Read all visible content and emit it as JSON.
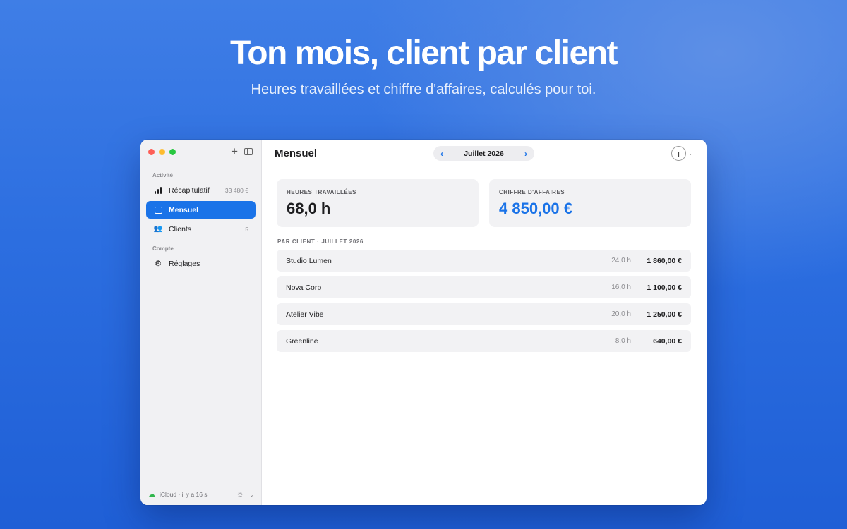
{
  "hero": {
    "title": "Ton mois, client par client",
    "subtitle": "Heures travaillées et chiffre d'affaires, calculés pour toi."
  },
  "sidebar": {
    "sections": [
      {
        "label": "Activité"
      },
      {
        "label": "Compte"
      }
    ],
    "items": [
      {
        "label": "Récapitulatif",
        "trail": "33 480 €",
        "icon": "bar-chart-icon"
      },
      {
        "label": "Mensuel",
        "trail": "",
        "icon": "calendar-icon",
        "active": true
      },
      {
        "label": "Clients",
        "trail": "5",
        "icon": "people-icon"
      },
      {
        "label": "Réglages",
        "trail": "",
        "icon": "gear-icon"
      }
    ],
    "footer": {
      "sync_text": "iCloud · il y a 16 s"
    }
  },
  "main": {
    "title": "Mensuel",
    "month": "Juillet 2026",
    "cards": [
      {
        "caption": "HEURES TRAVAILLÉES",
        "value": "68,0 h"
      },
      {
        "caption": "CHIFFRE D'AFFAIRES",
        "value": "4 850,00 €"
      }
    ],
    "list_label": "PAR CLIENT · JUILLET 2026",
    "clients": [
      {
        "name": "Studio Lumen",
        "hours": "24,0 h",
        "amount": "1 860,00 €"
      },
      {
        "name": "Nova Corp",
        "hours": "16,0 h",
        "amount": "1 100,00 €"
      },
      {
        "name": "Atelier Vibe",
        "hours": "20,0 h",
        "amount": "1 250,00 €"
      },
      {
        "name": "Greenline",
        "hours": "8,0 h",
        "amount": "640,00 €"
      }
    ]
  },
  "colors": {
    "accent": "#1a73e8",
    "background": "#2c6ee0",
    "sync_ok": "#31b64d"
  }
}
